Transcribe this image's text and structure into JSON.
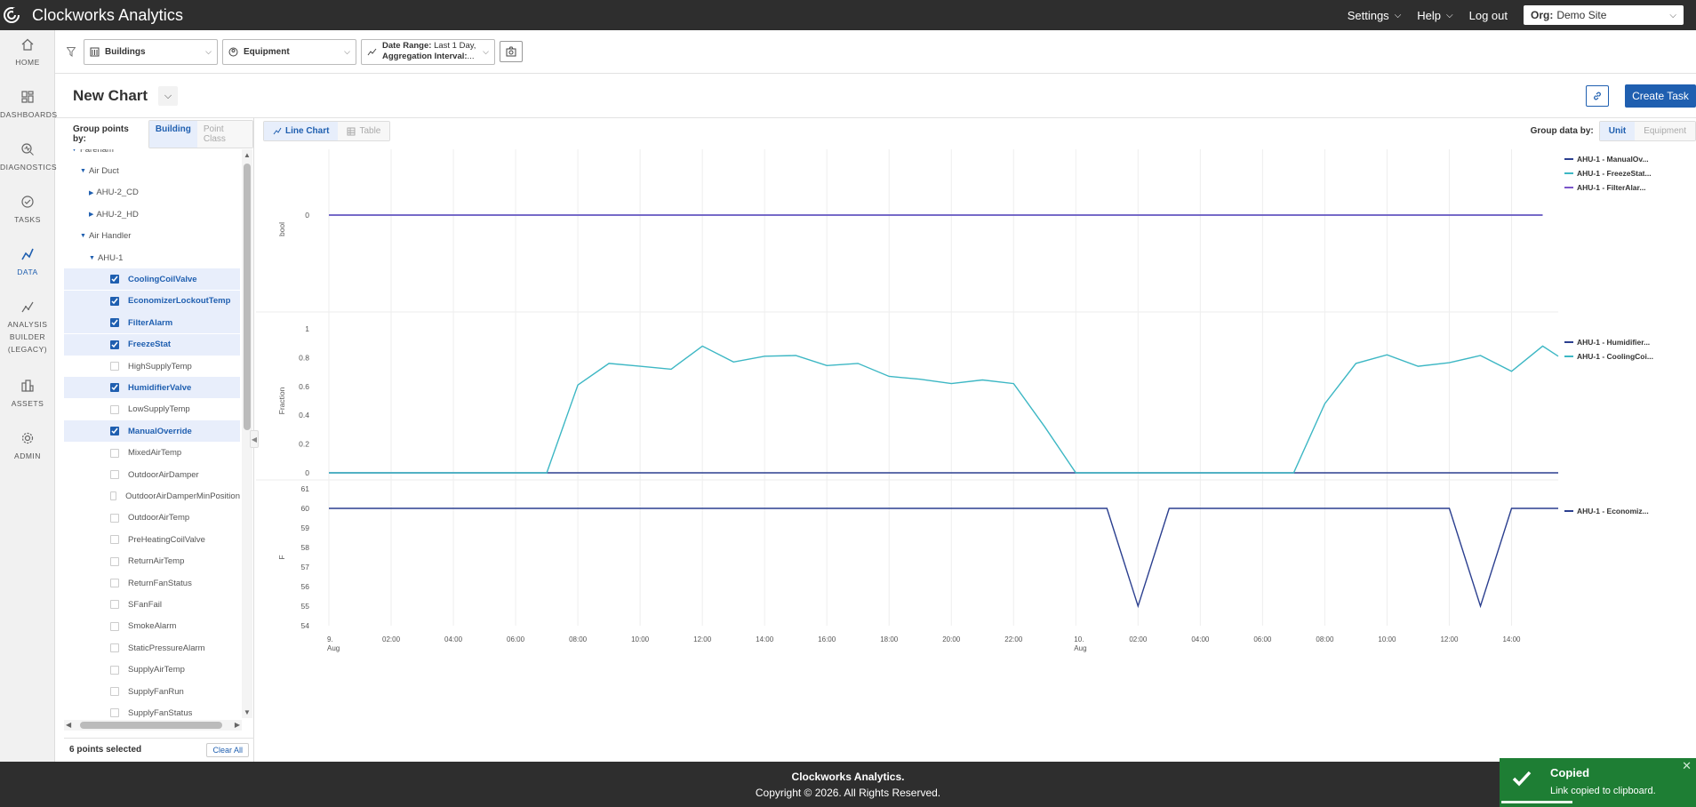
{
  "app": {
    "title": "Clockworks Analytics"
  },
  "topnav": {
    "settings": "Settings",
    "help": "Help",
    "logout": "Log out",
    "org_label": "Org:",
    "org_value": "Demo Site"
  },
  "leftnav": [
    {
      "label": "HOME",
      "icon": "home-icon"
    },
    {
      "label": "DASHBOARDS",
      "icon": "dashboard-icon"
    },
    {
      "label": "DIAGNOSTICS",
      "icon": "diagnostics-icon"
    },
    {
      "label": "TASKS",
      "icon": "tasks-icon"
    },
    {
      "label": "DATA",
      "icon": "data-icon",
      "active": true
    },
    {
      "label": "ANALYSIS BUILDER (LEGACY)",
      "label_lines": [
        "ANALYSIS",
        "BUILDER",
        "(LEGACY)"
      ],
      "icon": "analysis-icon"
    },
    {
      "label": "ASSETS",
      "icon": "assets-icon"
    },
    {
      "label": "ADMIN",
      "icon": "gear-icon"
    }
  ],
  "filters": {
    "buildings": "Buildings",
    "equipment": "Equipment",
    "date_range_label": "Date Range:",
    "date_range_value": "Last 1 Day,",
    "aggregation_label": "Aggregation Interval:",
    "aggregation_value": "..."
  },
  "page": {
    "title": "New Chart",
    "create_task": "Create Task"
  },
  "tree_panel": {
    "group_by_label": "Group points by:",
    "group_by_options": [
      "Building",
      "Point Class"
    ],
    "nodes": [
      {
        "label": "Fareham",
        "level": 0,
        "type": "open"
      },
      {
        "label": "Air Duct",
        "level": 1,
        "type": "open"
      },
      {
        "label": "AHU-2_CD",
        "level": 2,
        "type": "closed"
      },
      {
        "label": "AHU-2_HD",
        "level": 2,
        "type": "closed"
      },
      {
        "label": "Air Handler",
        "level": 1,
        "type": "open"
      },
      {
        "label": "AHU-1",
        "level": 2,
        "type": "open"
      },
      {
        "label": "CoolingCoilValve",
        "type": "point",
        "checked": true
      },
      {
        "label": "EconomizerLockoutTemp",
        "type": "point",
        "checked": true
      },
      {
        "label": "FilterAlarm",
        "type": "point",
        "checked": true
      },
      {
        "label": "FreezeStat",
        "type": "point",
        "checked": true
      },
      {
        "label": "HighSupplyTemp",
        "type": "point",
        "checked": false
      },
      {
        "label": "HumidifierValve",
        "type": "point",
        "checked": true
      },
      {
        "label": "LowSupplyTemp",
        "type": "point",
        "checked": false
      },
      {
        "label": "ManualOverride",
        "type": "point",
        "checked": true
      },
      {
        "label": "MixedAirTemp",
        "type": "point",
        "checked": false
      },
      {
        "label": "OutdoorAirDamper",
        "type": "point",
        "checked": false
      },
      {
        "label": "OutdoorAirDamperMinPosition",
        "type": "point",
        "checked": false
      },
      {
        "label": "OutdoorAirTemp",
        "type": "point",
        "checked": false
      },
      {
        "label": "PreHeatingCoilValve",
        "type": "point",
        "checked": false
      },
      {
        "label": "ReturnAirTemp",
        "type": "point",
        "checked": false
      },
      {
        "label": "ReturnFanStatus",
        "type": "point",
        "checked": false
      },
      {
        "label": "SFanFail",
        "type": "point",
        "checked": false
      },
      {
        "label": "SmokeAlarm",
        "type": "point",
        "checked": false
      },
      {
        "label": "StaticPressureAlarm",
        "type": "point",
        "checked": false
      },
      {
        "label": "SupplyAirTemp",
        "type": "point",
        "checked": false
      },
      {
        "label": "SupplyFanRun",
        "type": "point",
        "checked": false
      },
      {
        "label": "SupplyFanStatus",
        "type": "point",
        "checked": false
      }
    ],
    "selected_count": "6 points selected",
    "clear_all": "Clear All"
  },
  "chart_toolbar": {
    "view_options": [
      "Line Chart",
      "Table"
    ],
    "group_data_label": "Group data by:",
    "group_data_options": [
      "Unit",
      "Equipment"
    ]
  },
  "colors": {
    "accent": "#1f5fb0",
    "navy": "#2b3f8f",
    "teal": "#3db7c4",
    "purple": "#7a55c9",
    "toast": "#1e7e34"
  },
  "chart_data": [
    {
      "type": "line",
      "ylabel": "bool",
      "yticks": [
        0
      ],
      "ylim": [
        -1,
        1
      ],
      "legend": "top-right",
      "series": [
        {
          "name": "AHU-1 - ManualOv...",
          "color": "#2b3f8f",
          "x": [
            0,
            39
          ],
          "y": [
            0,
            0
          ]
        },
        {
          "name": "AHU-1 - FreezeStat...",
          "color": "#3db7c4",
          "x": [
            0,
            39
          ],
          "y": [
            0,
            0
          ]
        },
        {
          "name": "AHU-1 - FilterAlar...",
          "color": "#7a55c9",
          "x": [
            0,
            39
          ],
          "y": [
            0,
            0
          ]
        }
      ]
    },
    {
      "type": "line",
      "ylabel": "Fraction",
      "yticks": [
        0,
        0.2,
        0.4,
        0.6,
        0.8,
        1
      ],
      "ylim": [
        0,
        1
      ],
      "legend": "top-right",
      "series": [
        {
          "name": "AHU-1 - Humidifier...",
          "color": "#2b3f8f",
          "x": [
            0,
            39.5
          ],
          "y": [
            0,
            0
          ]
        },
        {
          "name": "AHU-1 - CoolingCoi...",
          "color": "#3db7c4",
          "x": [
            0,
            7,
            8,
            9,
            10,
            11,
            12,
            13,
            14,
            15,
            16,
            17,
            18,
            19,
            20,
            21,
            22,
            23,
            24,
            31,
            32,
            33,
            34,
            35,
            36,
            37,
            38,
            39,
            39.5
          ],
          "y": [
            0,
            0,
            0.61,
            0.76,
            0.74,
            0.72,
            0.88,
            0.77,
            0.81,
            0.815,
            0.745,
            0.76,
            0.67,
            0.65,
            0.62,
            0.645,
            0.62,
            0.32,
            0,
            0,
            0.48,
            0.76,
            0.82,
            0.74,
            0.765,
            0.815,
            0.705,
            0.88,
            0.81
          ]
        }
      ]
    },
    {
      "type": "line",
      "ylabel": "F",
      "yticks": [
        54,
        55,
        56,
        57,
        58,
        59,
        60,
        61
      ],
      "ylim": [
        54,
        61
      ],
      "legend": "top-right",
      "xtick_labels": [
        "9. Aug",
        "02:00",
        "04:00",
        "06:00",
        "08:00",
        "10:00",
        "12:00",
        "14:00",
        "16:00",
        "18:00",
        "20:00",
        "22:00",
        "10. Aug",
        "02:00",
        "04:00",
        "06:00",
        "08:00",
        "10:00",
        "12:00",
        "14:00"
      ],
      "series": [
        {
          "name": "AHU-1 - Economiz...",
          "color": "#2b3f8f",
          "x": [
            0,
            25,
            26,
            27,
            36,
            37,
            38,
            39.5
          ],
          "y": [
            60,
            60,
            55,
            60,
            60,
            55,
            60,
            60
          ]
        }
      ]
    }
  ],
  "toast": {
    "title": "Copied",
    "message": "Link copied to clipboard."
  },
  "footer": {
    "brand": "Clockworks Analytics.",
    "copyright": "Copyright © 2026. All Rights Reserved."
  }
}
